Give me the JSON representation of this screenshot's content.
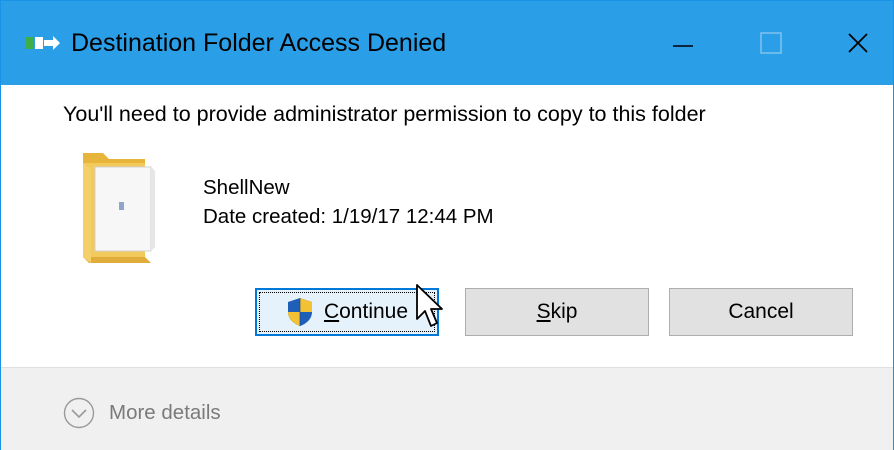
{
  "window": {
    "title": "Destination Folder Access Denied",
    "controls": {
      "minimize_icon": "minimize-icon",
      "maximize_icon": "maximize-icon",
      "close_icon": "close-icon"
    }
  },
  "dialog": {
    "message": "You'll need to provide administrator permission to copy to this folder",
    "item": {
      "icon": "folder-icon",
      "name": "ShellNew",
      "date_created": "Date created: 1/19/17 12:44 PM"
    }
  },
  "buttons": {
    "continue": {
      "mnemonic": "C",
      "rest": "ontinue",
      "icon": "uac-shield-icon"
    },
    "skip": {
      "mnemonic": "S",
      "rest": "kip"
    },
    "cancel": {
      "label": "Cancel"
    }
  },
  "footer": {
    "more_details_label": "More details",
    "icon": "chevron-down-circle-icon"
  },
  "colors": {
    "titlebar": "#2a9fe8",
    "border": "#1a93e6",
    "button_focus_border": "#0078d7",
    "button_focus_bg": "#e5f1fb",
    "button_bg": "#e1e1e1",
    "footer_bg": "#f0f0f0",
    "muted_text": "#7a7a7a"
  }
}
